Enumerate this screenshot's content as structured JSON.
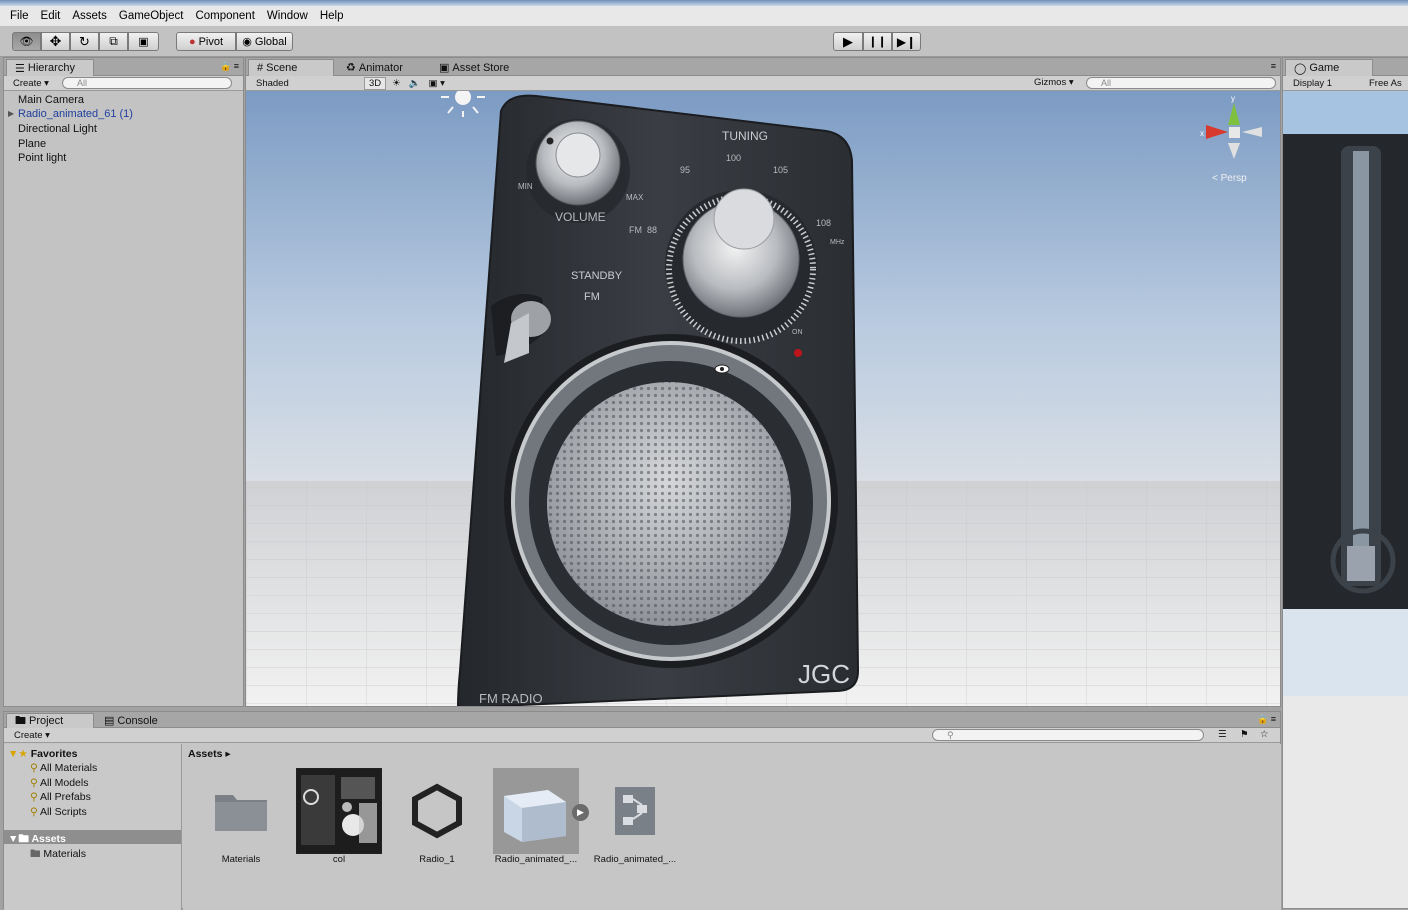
{
  "menu": [
    "File",
    "Edit",
    "Assets",
    "GameObject",
    "Component",
    "Window",
    "Help"
  ],
  "toolbar": {
    "pivot": "Pivot",
    "global": "Global"
  },
  "hierarchy": {
    "tab": "Hierarchy",
    "create": "Create",
    "search": "All",
    "items": [
      {
        "label": "Main Camera",
        "color": "#111111"
      },
      {
        "label": "Radio_animated_61 (1)",
        "color": "#1f3f9f"
      },
      {
        "label": "Directional Light",
        "color": "#111111"
      },
      {
        "label": "Plane",
        "color": "#111111"
      },
      {
        "label": "Point light",
        "color": "#111111"
      }
    ]
  },
  "scene": {
    "tabs": [
      "Scene",
      "Animator",
      "Asset Store"
    ],
    "shading": "Shaded",
    "mode2d": "3D",
    "gizmos": "Gizmos",
    "search": "All",
    "persp": "Persp",
    "radio": {
      "tuning": "TUNING",
      "volume": "VOLUME",
      "min": "MIN",
      "max": "MAX",
      "standby": "STANDBY",
      "fm": "FM",
      "on": "ON",
      "brand": "JGC",
      "model": "FM RADIO",
      "dial": [
        "88",
        "95",
        "100",
        "105",
        "108",
        "MHz"
      ],
      "band": "FM"
    }
  },
  "game": {
    "tab": "Game",
    "display": "Display 1",
    "aspect": "Free As"
  },
  "project": {
    "tabs": [
      "Project",
      "Console"
    ],
    "create": "Create",
    "favorites_label": "Favorites",
    "favorites": [
      "All Materials",
      "All Models",
      "All Prefabs",
      "All Scripts"
    ],
    "assets_root": "Assets",
    "assets_folders": [
      "Materials"
    ],
    "breadcrumb": "Assets",
    "items": [
      "Materials",
      "col",
      "Radio_1",
      "Radio_animated_...",
      "Radio_animated_..."
    ]
  },
  "colors": {
    "accent": "#3d6fc9",
    "radioBody": "#2d3035",
    "sky": "#a7c3e2"
  }
}
